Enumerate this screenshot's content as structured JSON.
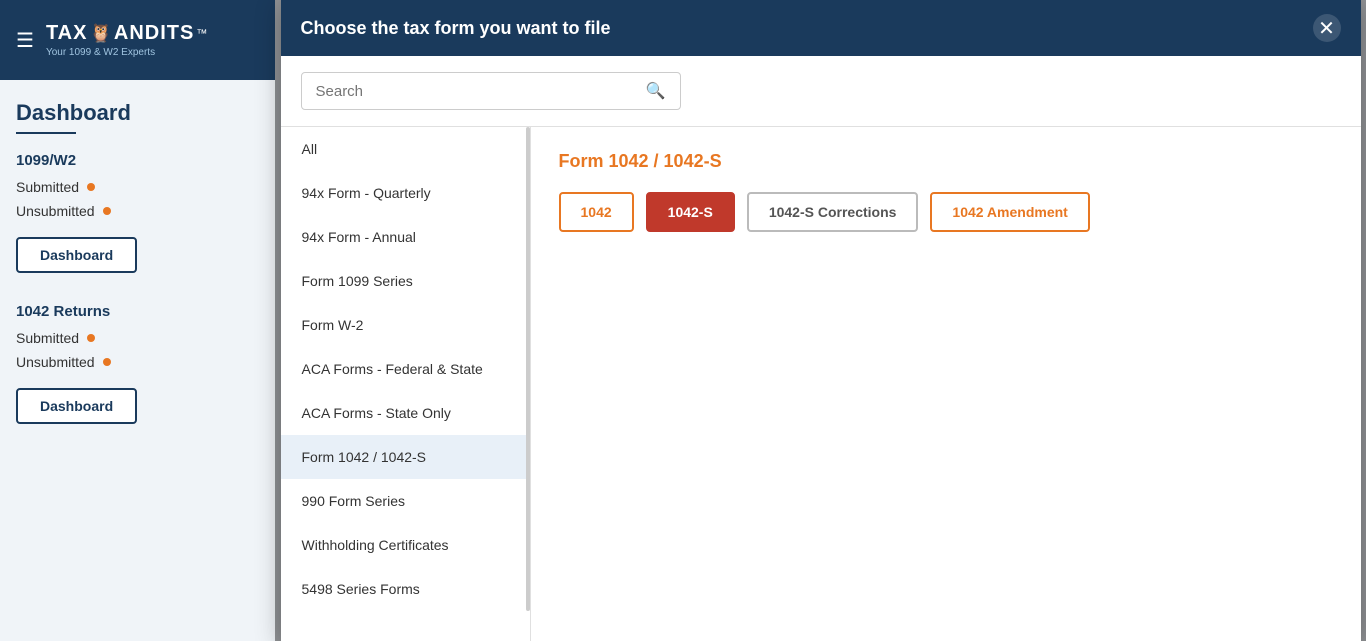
{
  "sidebar": {
    "title": "Dashboard",
    "hamburger": "☰",
    "logo": {
      "text": "TAX🦉ANDITS™",
      "tagline": "Your 1099 & W2 Experts"
    },
    "section1": {
      "label": "1099/W2",
      "submitted": "Submitted",
      "unsubmitted": "Unsubmitted",
      "dashboard_btn": "Dashboard"
    },
    "section2": {
      "label": "1042 Returns",
      "submitted": "Submitted",
      "unsubmitted": "Unsubmitted",
      "dashboard_btn": "Dashboard"
    }
  },
  "modal": {
    "title": "Choose the tax form you want to file",
    "close_label": "✕",
    "search_placeholder": "Search",
    "nav_items": [
      {
        "id": "all",
        "label": "All",
        "active": false
      },
      {
        "id": "94x-quarterly",
        "label": "94x Form - Quarterly",
        "active": false
      },
      {
        "id": "94x-annual",
        "label": "94x Form - Annual",
        "active": false
      },
      {
        "id": "form-1099",
        "label": "Form 1099 Series",
        "active": false
      },
      {
        "id": "form-w2",
        "label": "Form W-2",
        "active": false
      },
      {
        "id": "aca-federal-state",
        "label": "ACA Forms - Federal & State",
        "active": false
      },
      {
        "id": "aca-state-only",
        "label": "ACA Forms - State Only",
        "active": false
      },
      {
        "id": "form-1042",
        "label": "Form 1042 / 1042-S",
        "active": true
      },
      {
        "id": "990-series",
        "label": "990 Form Series",
        "active": false
      },
      {
        "id": "withholding",
        "label": "Withholding Certificates",
        "active": false
      },
      {
        "id": "5498-series",
        "label": "5498 Series Forms",
        "active": false
      }
    ],
    "content": {
      "section_title": "Form 1042 / 1042-S",
      "buttons": [
        {
          "id": "1042",
          "label": "1042",
          "style": "outline"
        },
        {
          "id": "1042-s",
          "label": "1042-S",
          "style": "active"
        },
        {
          "id": "1042-s-corrections",
          "label": "1042-S Corrections",
          "style": "grey"
        },
        {
          "id": "1042-amendment",
          "label": "1042 Amendment",
          "style": "outline"
        }
      ]
    }
  }
}
